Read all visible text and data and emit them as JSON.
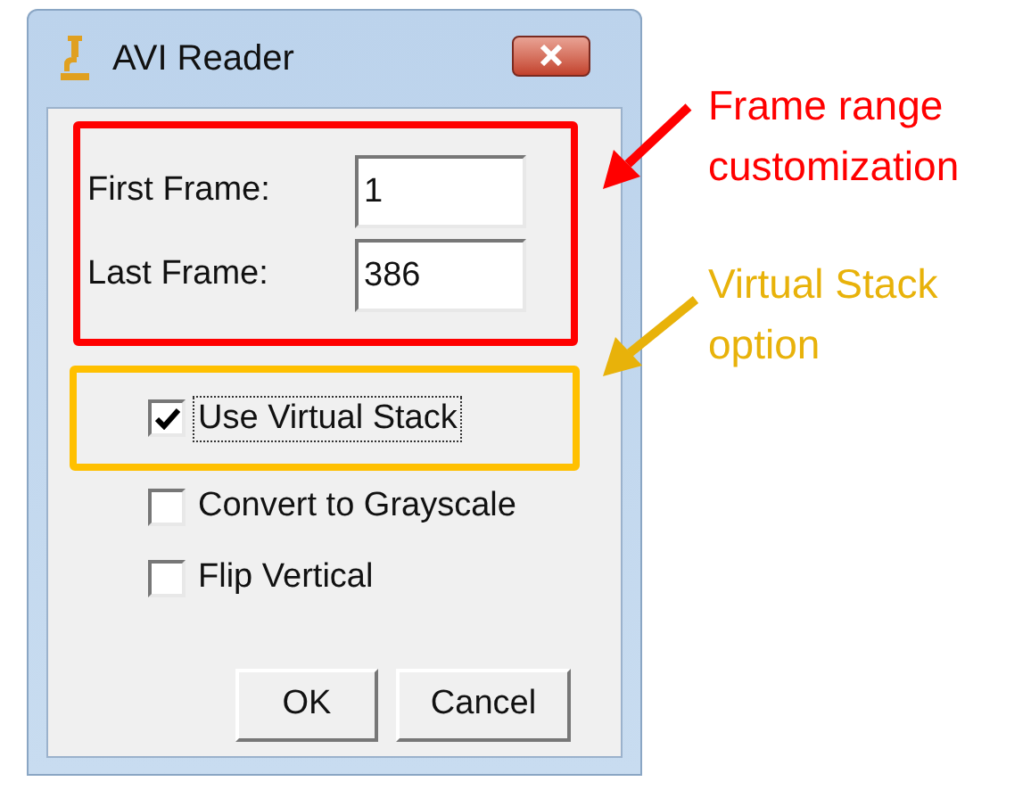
{
  "window": {
    "title": "AVI Reader"
  },
  "fields": [
    {
      "label": "First Frame:",
      "value": "1"
    },
    {
      "label": "Last Frame:",
      "value": "386"
    }
  ],
  "checkboxes": [
    {
      "label": "Use Virtual Stack",
      "checked": true,
      "focused": true
    },
    {
      "label": "Convert to Grayscale",
      "checked": false,
      "focused": false
    },
    {
      "label": "Flip Vertical",
      "checked": false,
      "focused": false
    }
  ],
  "buttons": [
    "OK",
    "Cancel"
  ],
  "annotations": [
    {
      "lines": [
        "Frame range",
        "customization"
      ],
      "color": "#ff0000"
    },
    {
      "lines": [
        "Virtual Stack",
        "option"
      ],
      "color": "#e8b20a"
    }
  ]
}
